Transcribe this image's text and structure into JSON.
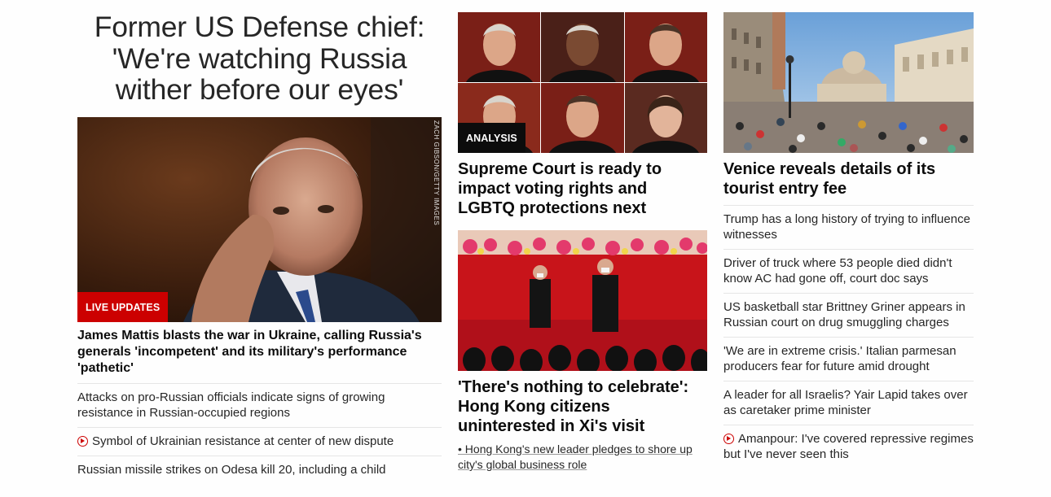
{
  "lead": {
    "title": "Former US Defense chief: 'We're watching Russia wither before our eyes'",
    "image_credit": "ZACH GIBSON/GETTY IMAGES",
    "badge": "LIVE UPDATES",
    "headline": "James Mattis blasts the war in Ukraine, calling Russia's generals 'incompetent' and its military's performance 'pathetic'",
    "links": [
      {
        "text": "Attacks on pro-Russian officials indicate signs of growing resistance in Russian-occupied regions",
        "video": false
      },
      {
        "text": "Symbol of Ukrainian resistance at center of new dispute",
        "video": true
      },
      {
        "text": "Russian missile strikes on Odesa kill 20, including a child",
        "video": false
      }
    ]
  },
  "middle": {
    "story1": {
      "badge": "ANALYSIS",
      "headline": "Supreme Court is ready to impact voting rights and LGBTQ protections next"
    },
    "story2": {
      "headline": "'There's nothing to celebrate': Hong Kong citizens uninterested in Xi's visit",
      "bullet": "• Hong Kong's new leader pledges to shore up city's global business role"
    }
  },
  "right": {
    "headline": "Venice reveals details of its tourist entry fee",
    "links": [
      {
        "text": "Trump has a long history of trying to influence witnesses",
        "video": false
      },
      {
        "text": "Driver of truck where 53 people died didn't know AC had gone off, court doc says",
        "video": false
      },
      {
        "text": "US basketball star Brittney Griner appears in Russian court on drug smuggling charges",
        "video": false
      },
      {
        "text": "'We are in extreme crisis.' Italian parmesan producers fear for future amid drought",
        "video": false
      },
      {
        "text": "A leader for all Israelis? Yair Lapid takes over as caretaker prime minister",
        "video": false
      },
      {
        "text": "Amanpour: I've covered repressive regimes but I've never seen this",
        "video": true
      }
    ]
  },
  "colors": {
    "accent_red": "#cc0000",
    "text": "#0c0c0c",
    "divider": "#e6e6e6"
  }
}
